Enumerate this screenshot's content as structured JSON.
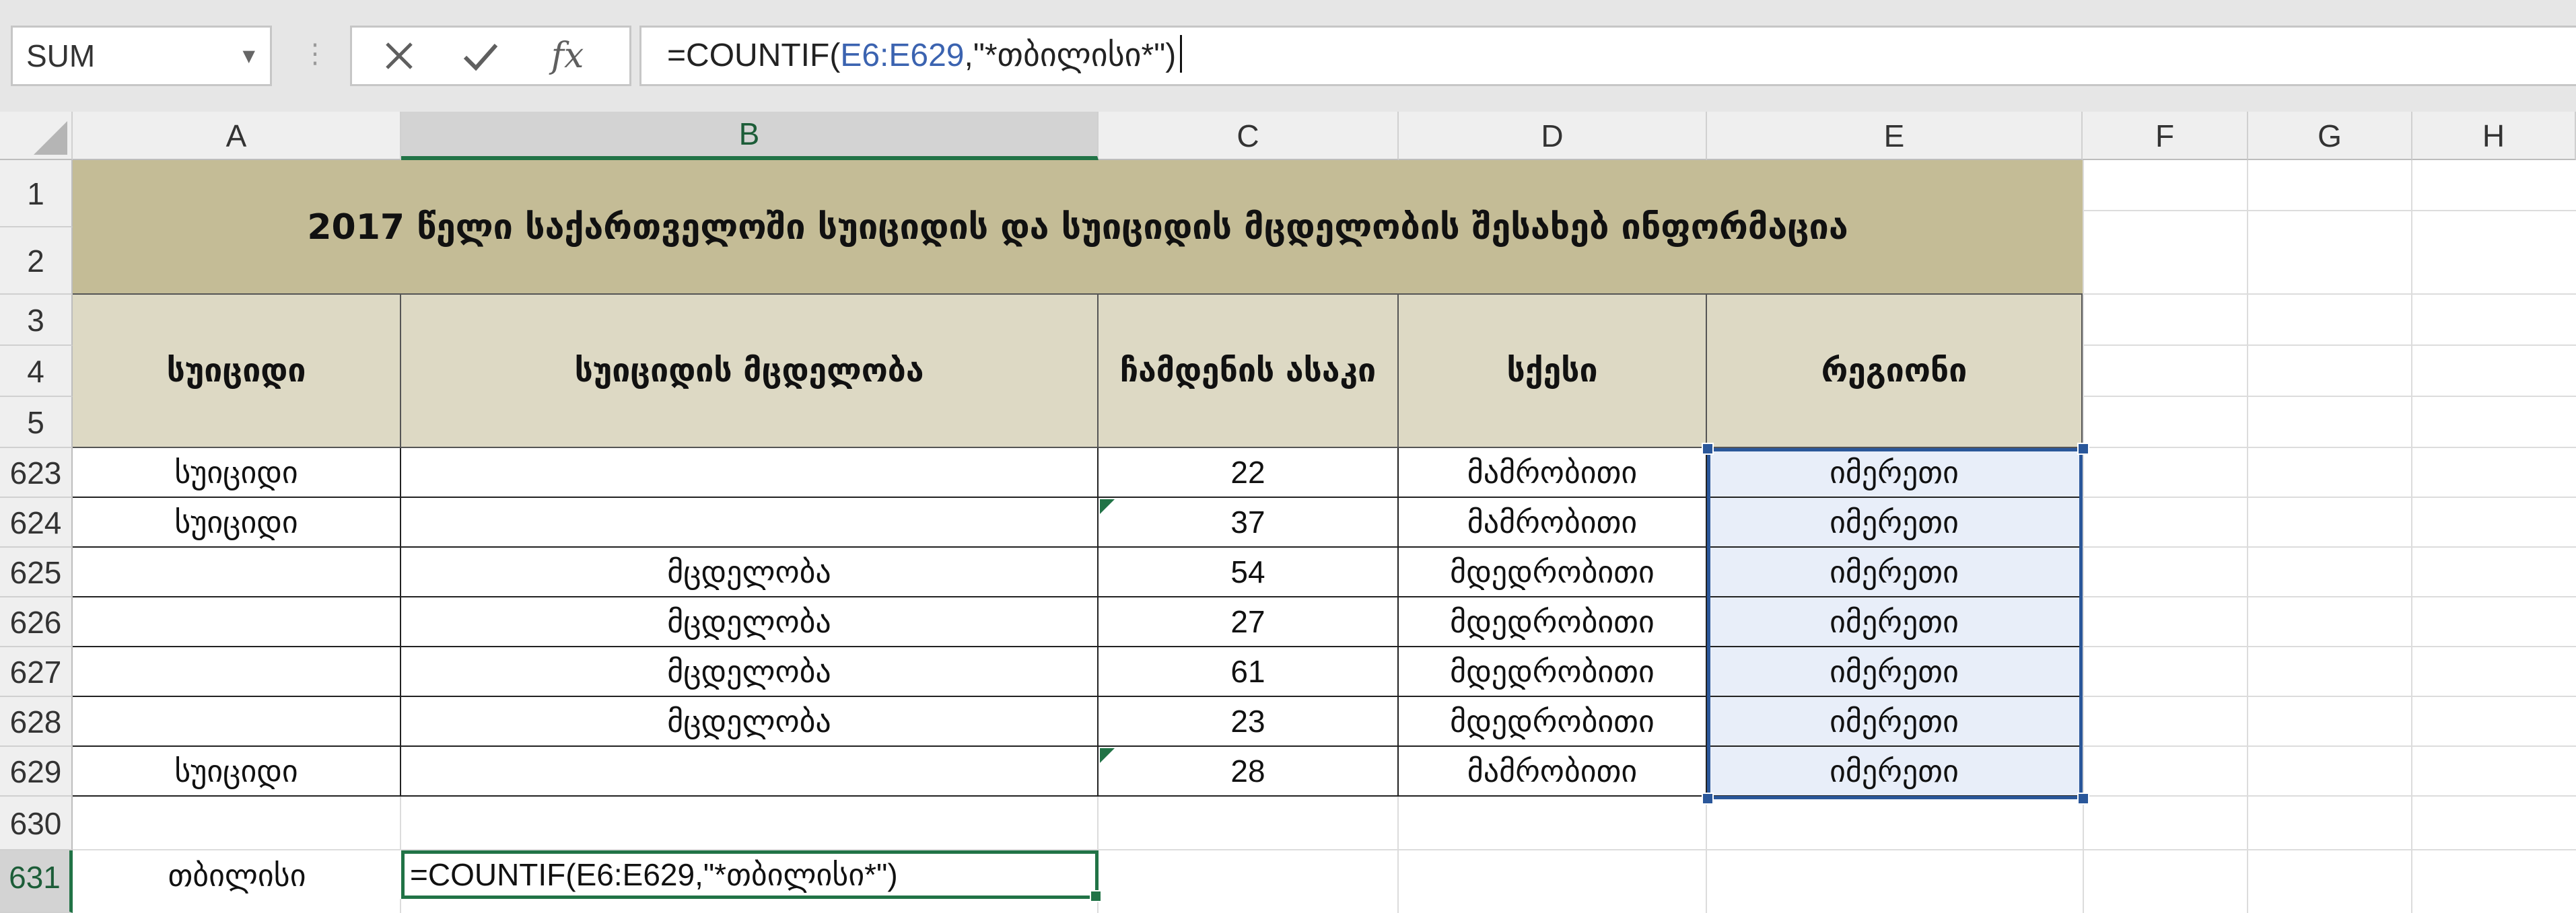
{
  "namebox": {
    "value": "SUM"
  },
  "formula_bar": {
    "prefix": "=COUNTIF(",
    "ref": "E6:E629",
    "suffix": ",\"*თბილისი*\")"
  },
  "columns": [
    "A",
    "B",
    "C",
    "D",
    "E",
    "F",
    "G",
    "H"
  ],
  "selected_column": "B",
  "rows": [
    "1",
    "2",
    "3",
    "4",
    "5",
    "623",
    "624",
    "625",
    "626",
    "627",
    "628",
    "629",
    "630",
    "631"
  ],
  "selected_row": "631",
  "banner": "2017 წელი   საქართველოში სუიციდის და სუიციდის მცდელობის შესახებ ინფორმაცია",
  "headers": {
    "a": "სუიციდი",
    "b": "სუიციდის მცდელობა",
    "c": "ჩამდენის ასაკი",
    "d": "სქესი",
    "e": "რეგიონი"
  },
  "data_rows": [
    {
      "a": "სუიციდი",
      "b": "",
      "c": "22",
      "d": "მამრობითი",
      "e": "იმერეთი"
    },
    {
      "a": "სუიციდი",
      "b": "",
      "c": "37",
      "d": "მამრობითი",
      "e": "იმერეთი"
    },
    {
      "a": "",
      "b": "მცდელობა",
      "c": "54",
      "d": "მდედრობითი",
      "e": "იმერეთი"
    },
    {
      "a": "",
      "b": "მცდელობა",
      "c": "27",
      "d": "მდედრობითი",
      "e": "იმერეთი"
    },
    {
      "a": "",
      "b": "მცდელობა",
      "c": "61",
      "d": "მდედრობითი",
      "e": "იმერეთი"
    },
    {
      "a": "",
      "b": "მცდელობა",
      "c": "23",
      "d": "მდედრობითი",
      "e": "იმერეთი"
    },
    {
      "a": "სუიციდი",
      "b": "",
      "c": "28",
      "d": "მამრობითი",
      "e": "იმერეთი"
    }
  ],
  "row631": {
    "a": "თბილისი",
    "b": "=COUNTIF(E6:E629,\"*თბილისი*\")"
  }
}
